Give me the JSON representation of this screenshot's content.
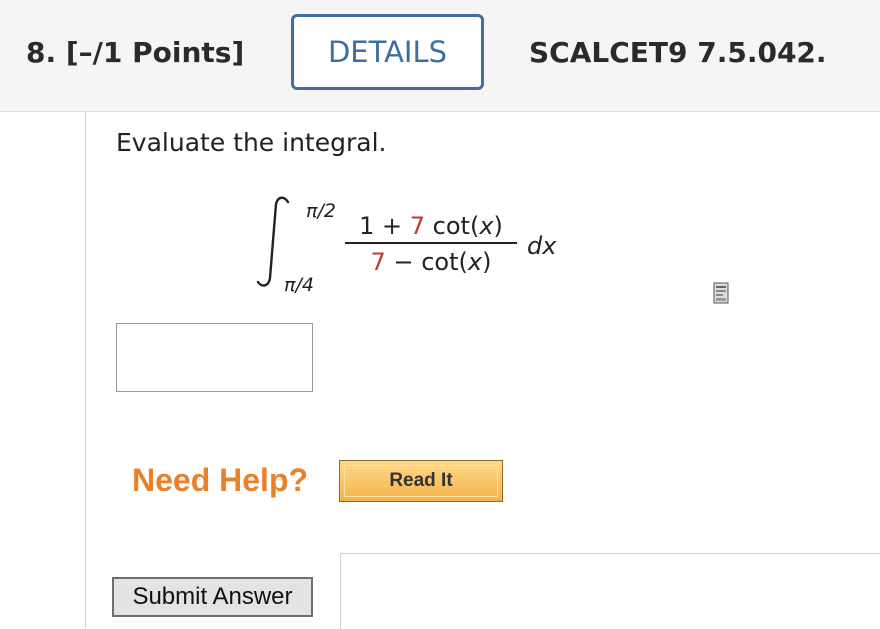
{
  "header": {
    "question_number": "8. [–/1 Points]",
    "details_label": "DETAILS",
    "problem_code": "SCALCET9 7.5.042."
  },
  "question": {
    "prompt": "Evaluate the integral.",
    "integral": {
      "upper_limit": "π/2",
      "lower_limit": "π/4",
      "numerator": {
        "coeff_a": "1",
        "op": " + ",
        "coeff_b": "7",
        "func": " cot(",
        "var": "x",
        "close": ")"
      },
      "denominator": {
        "coeff_a": "7",
        "op": " − ",
        "func": "cot(",
        "var": "x",
        "close": ")"
      },
      "differential": "dx"
    }
  },
  "answer": {
    "value": "",
    "placeholder": ""
  },
  "help": {
    "need_help_label": "Need Help?",
    "read_it_label": "Read It"
  },
  "submit": {
    "label": "Submit Answer"
  },
  "colors": {
    "accent": "#3e6ea1",
    "highlight_red": "#c0392b",
    "help_orange": "#e8812a"
  }
}
